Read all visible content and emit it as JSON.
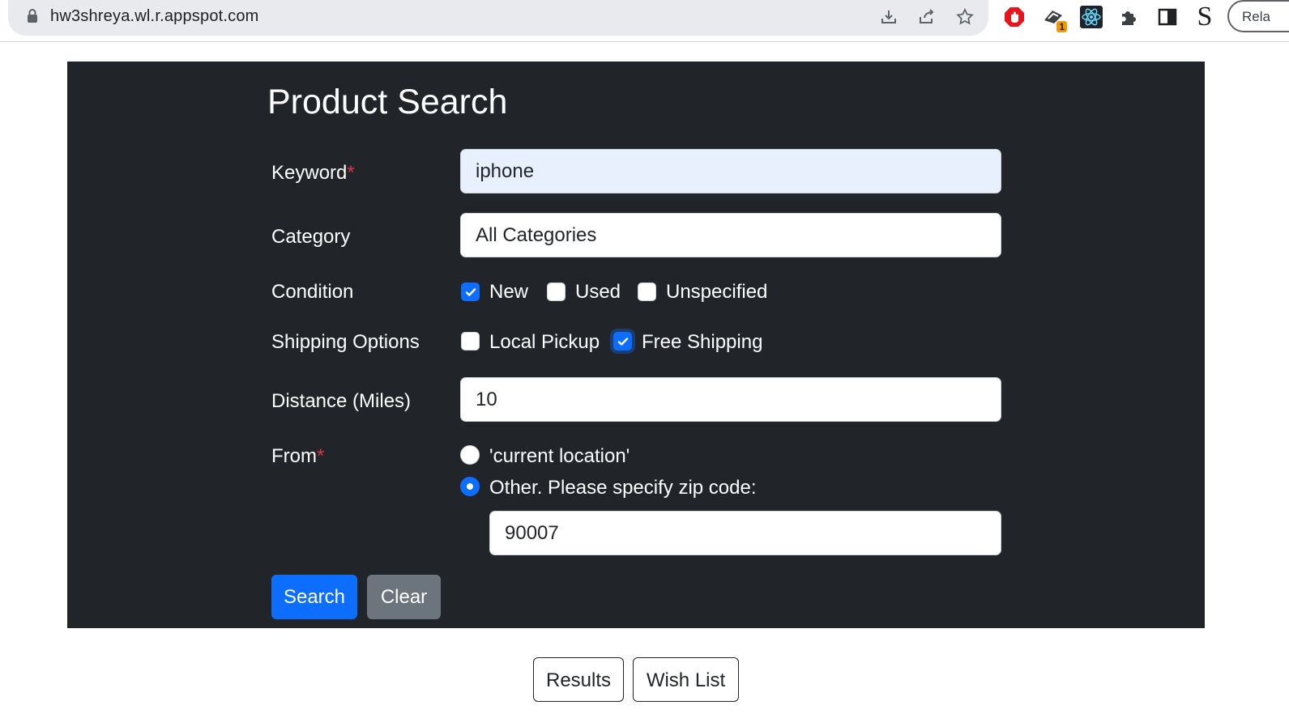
{
  "browser": {
    "url": "hw3shreya.wl.r.appspot.com",
    "relaunch_label": "Rela",
    "extension_badge": "1",
    "profile_letter": "S"
  },
  "form": {
    "title": "Product Search",
    "required_mark": "*",
    "keyword": {
      "label": "Keyword",
      "value": "iphone"
    },
    "category": {
      "label": "Category",
      "value": "All Categories"
    },
    "condition": {
      "label": "Condition",
      "options": [
        {
          "label": "New",
          "checked": true
        },
        {
          "label": "Used",
          "checked": false
        },
        {
          "label": "Unspecified",
          "checked": false
        }
      ]
    },
    "shipping": {
      "label": "Shipping Options",
      "options": [
        {
          "label": "Local Pickup",
          "checked": false
        },
        {
          "label": "Free Shipping",
          "checked": true
        }
      ]
    },
    "distance": {
      "label": "Distance (Miles)",
      "value": "10"
    },
    "from": {
      "label": "From",
      "options": [
        {
          "label": "'current location'",
          "selected": false
        },
        {
          "label": "Other. Please specify zip code:",
          "selected": true
        }
      ],
      "zip_value": "90007"
    },
    "buttons": {
      "search": "Search",
      "clear": "Clear"
    }
  },
  "bottom_tabs": {
    "results": "Results",
    "wishlist": "Wish List"
  },
  "colors": {
    "panel": "#212529",
    "primary": "#0d6efd",
    "secondary": "#6c757d",
    "required": "#dc3545",
    "autofill": "#e8f0fe"
  }
}
